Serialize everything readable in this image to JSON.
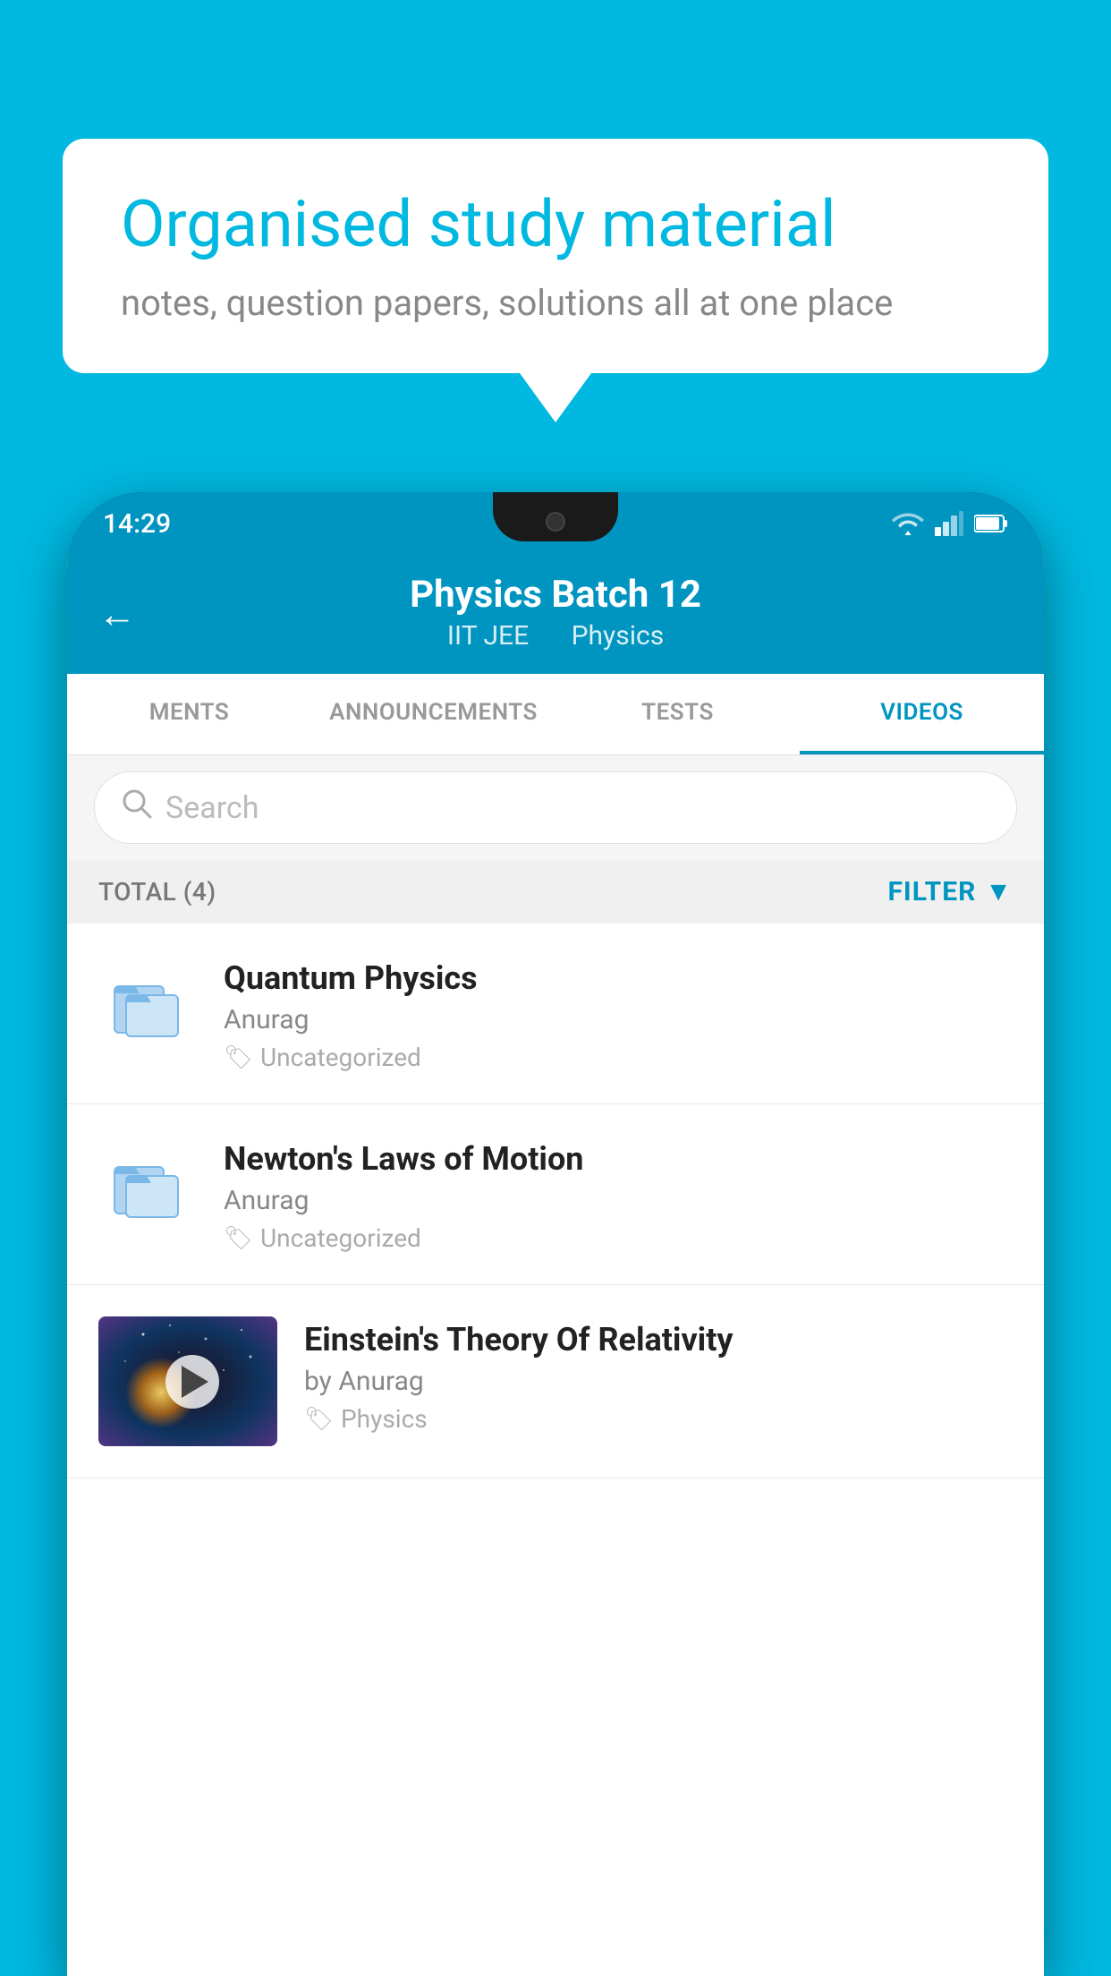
{
  "background_color": "#00b8e0",
  "bubble": {
    "title": "Organised study material",
    "subtitle": "notes, question papers, solutions all at one place"
  },
  "status_bar": {
    "time": "14:29",
    "color": "#0095c0"
  },
  "header": {
    "title": "Physics Batch 12",
    "subtitle_part1": "IIT JEE",
    "subtitle_part2": "Physics",
    "back_label": "←"
  },
  "tabs": [
    {
      "label": "MENTS",
      "active": false
    },
    {
      "label": "ANNOUNCEMENTS",
      "active": false
    },
    {
      "label": "TESTS",
      "active": false
    },
    {
      "label": "VIDEOS",
      "active": true
    }
  ],
  "search": {
    "placeholder": "Search"
  },
  "filter_bar": {
    "total_label": "TOTAL (4)",
    "filter_label": "FILTER"
  },
  "videos": [
    {
      "title": "Quantum Physics",
      "author": "Anurag",
      "tag": "Uncategorized",
      "type": "folder"
    },
    {
      "title": "Newton's Laws of Motion",
      "author": "Anurag",
      "tag": "Uncategorized",
      "type": "folder"
    },
    {
      "title": "Einstein's Theory Of Relativity",
      "author": "by Anurag",
      "tag": "Physics",
      "type": "video"
    }
  ]
}
